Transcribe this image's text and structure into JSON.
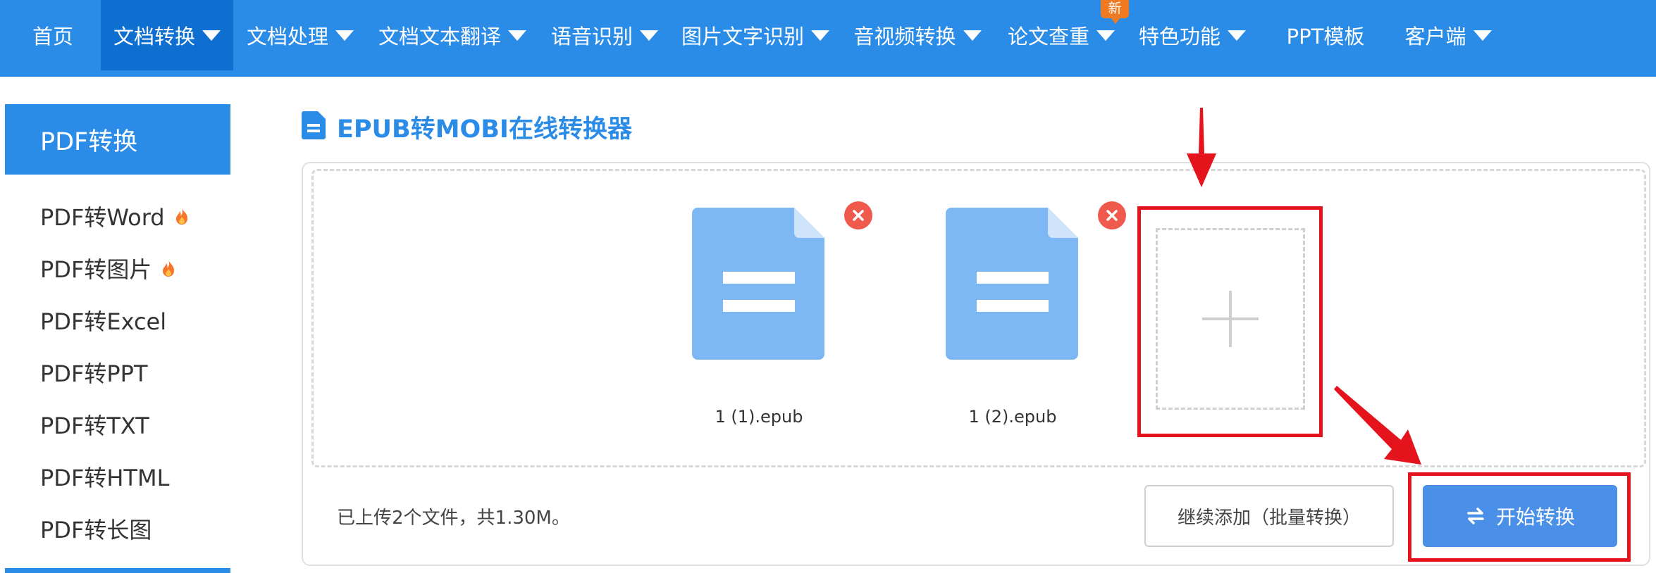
{
  "nav": {
    "items": [
      {
        "label": "首页",
        "has_dropdown": false
      },
      {
        "label": "文档转换",
        "has_dropdown": true,
        "active": true
      },
      {
        "label": "文档处理",
        "has_dropdown": true
      },
      {
        "label": "文档文本翻译",
        "has_dropdown": true
      },
      {
        "label": "语音识别",
        "has_dropdown": true
      },
      {
        "label": "图片文字识别",
        "has_dropdown": true
      },
      {
        "label": "音视频转换",
        "has_dropdown": true
      },
      {
        "label": "论文查重",
        "has_dropdown": true,
        "badge": "新"
      },
      {
        "label": "特色功能",
        "has_dropdown": true
      },
      {
        "label": "PPT模板",
        "has_dropdown": false
      },
      {
        "label": "客户端",
        "has_dropdown": true
      }
    ],
    "colors": {
      "bar": "#2b8ce8",
      "active": "#0f6fd0",
      "badge": "#f07a22"
    }
  },
  "sidebar": {
    "header": "PDF转换",
    "items": [
      {
        "label": "PDF转Word",
        "hot": true
      },
      {
        "label": "PDF转图片",
        "hot": true
      },
      {
        "label": "PDF转Excel",
        "hot": false
      },
      {
        "label": "PDF转PPT",
        "hot": false
      },
      {
        "label": "PDF转TXT",
        "hot": false
      },
      {
        "label": "PDF转HTML",
        "hot": false
      },
      {
        "label": "PDF转长图",
        "hot": false
      }
    ]
  },
  "main": {
    "title": "EPUB转MOBI在线转换器",
    "title_icon": "document-icon",
    "files": [
      {
        "name": "1 (1).epub",
        "icon": "file-icon"
      },
      {
        "name": "1 (2).epub",
        "icon": "file-icon"
      }
    ],
    "remove_icon": "close-circle-icon",
    "add_icon": "plus-icon",
    "status": "已上传2个文件，共1.30M。",
    "continue_button": "继续添加（批量转换）",
    "start_button": "开始转换",
    "start_icon": "swap-icon"
  },
  "annotations": {
    "color": "#e5141c"
  }
}
